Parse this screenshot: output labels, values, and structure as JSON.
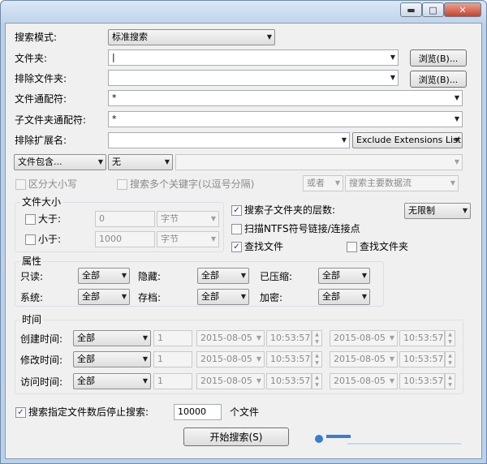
{
  "window": {
    "buttons": {
      "minimize": "▬",
      "maximize": "□",
      "close": "✕"
    }
  },
  "rows": {
    "search_mode": {
      "label": "搜索模式:",
      "value": "标准搜索"
    },
    "folder": {
      "label": "文件夹:",
      "value": "|",
      "browse": "浏览(B)..."
    },
    "exclude_folder": {
      "label": "排除文件夹:",
      "value": "",
      "browse": "浏览(B)..."
    },
    "file_wildcard": {
      "label": "文件通配符:",
      "value": "*"
    },
    "subfolder_wildcard": {
      "label": "子文件夹通配符:",
      "value": "*"
    },
    "exclude_ext": {
      "label": "排除扩展名:",
      "value": "",
      "list": "Exclude Extensions List"
    }
  },
  "contains": {
    "mode": "文件包含...",
    "type": "无",
    "text": ""
  },
  "case_sensitive": "区分大小写",
  "multi_keywords": "搜索多个关键字(以逗号分隔)",
  "or_option": "或者",
  "search_stream": "搜索主要数据流",
  "file_size": {
    "title": "文件大小",
    "greater": {
      "label": "大于:",
      "value": "0",
      "unit": "字节"
    },
    "less": {
      "label": "小于:",
      "value": "1000",
      "unit": "字节"
    }
  },
  "options": {
    "search_sub_levels": "搜索子文件夹的层数:",
    "levels_value": "无限制",
    "scan_ntfs": "扫描NTFS符号链接/连接点",
    "find_files": "查找文件",
    "find_folders": "查找文件夹"
  },
  "attributes": {
    "title": "属性",
    "readonly": {
      "label": "只读:",
      "value": "全部"
    },
    "hidden": {
      "label": "隐藏:",
      "value": "全部"
    },
    "compressed": {
      "label": "已压缩:",
      "value": "全部"
    },
    "system": {
      "label": "系统:",
      "value": "全部"
    },
    "archive": {
      "label": "存档:",
      "value": "全部"
    },
    "encrypted": {
      "label": "加密:",
      "value": "全部"
    }
  },
  "time": {
    "title": "时间",
    "rows": [
      {
        "label": "创建时间:",
        "mode": "全部",
        "num": "1",
        "date1": "2015-08-05",
        "time1": "10:53:57",
        "date2": "2015-08-05",
        "time2": "10:53:57"
      },
      {
        "label": "修改时间:",
        "mode": "全部",
        "num": "1",
        "date1": "2015-08-05",
        "time1": "10:53:57",
        "date2": "2015-08-05",
        "time2": "10:53:57"
      },
      {
        "label": "访问时间:",
        "mode": "全部",
        "num": "1",
        "date1": "2015-08-05",
        "time1": "10:53:57",
        "date2": "2015-08-05",
        "time2": "10:53:57"
      }
    ]
  },
  "stop_after": {
    "label": "搜索指定文件数后停止搜索:",
    "value": "10000",
    "unit": "个文件"
  },
  "start_button": "开始搜索(S)"
}
